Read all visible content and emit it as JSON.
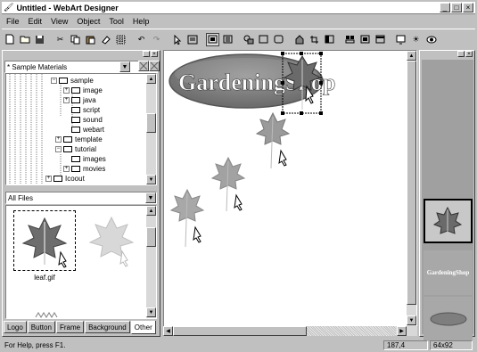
{
  "window": {
    "title": "Untitled - WebArt Designer",
    "controls": [
      "_",
      "□",
      "×"
    ]
  },
  "menu": [
    "File",
    "Edit",
    "View",
    "Object",
    "Tool",
    "Help"
  ],
  "toolbar": {
    "buttons": [
      "new-icon",
      "open-icon",
      "save-icon",
      "cut-icon",
      "copy-icon",
      "paste-icon",
      "eraser-icon",
      "grid-icon",
      "undo-icon",
      "redo-icon",
      "pointer-icon",
      "select-icon",
      "frame-icon",
      "layers-icon",
      "shapes-icon",
      "rect-icon",
      "rounded-rect-icon",
      "image-icon",
      "crop-icon",
      "crop2-icon",
      "align-icon",
      "group-icon",
      "window-icon",
      "monitor-icon",
      "sun-icon",
      "eye-icon"
    ]
  },
  "left_panel": {
    "materials_combo": "* Sample Materials",
    "tree": [
      {
        "label": "sample",
        "level": 1,
        "expanded": true
      },
      {
        "label": "image",
        "level": 2,
        "expanded": false
      },
      {
        "label": "java",
        "level": 2,
        "expanded": false
      },
      {
        "label": "script",
        "level": 2,
        "expanded": null
      },
      {
        "label": "sound",
        "level": 2,
        "expanded": null
      },
      {
        "label": "webart",
        "level": 2,
        "expanded": null
      },
      {
        "label": "template",
        "level": 1,
        "expanded": false
      },
      {
        "label": "tutorial",
        "level": 1,
        "expanded": true
      },
      {
        "label": "images",
        "level": 2,
        "expanded": null
      },
      {
        "label": "movies",
        "level": 2,
        "expanded": false
      },
      {
        "label": "Icoout",
        "level": 0,
        "expanded": false
      }
    ],
    "file_filter": "All Files",
    "files": [
      {
        "name": "leaf.gif"
      }
    ],
    "tabs": [
      "Logo",
      "Button",
      "Frame",
      "Background",
      "Other"
    ],
    "active_tab": "Other"
  },
  "canvas": {
    "banner_text": "GardeningShop",
    "banner_color": "#7e7e7e"
  },
  "right_panel": {
    "thumb_banner_text": "GardeningShop"
  },
  "status": {
    "help": "For Help, press F1.",
    "coords": "187,4",
    "size": "64x92"
  }
}
